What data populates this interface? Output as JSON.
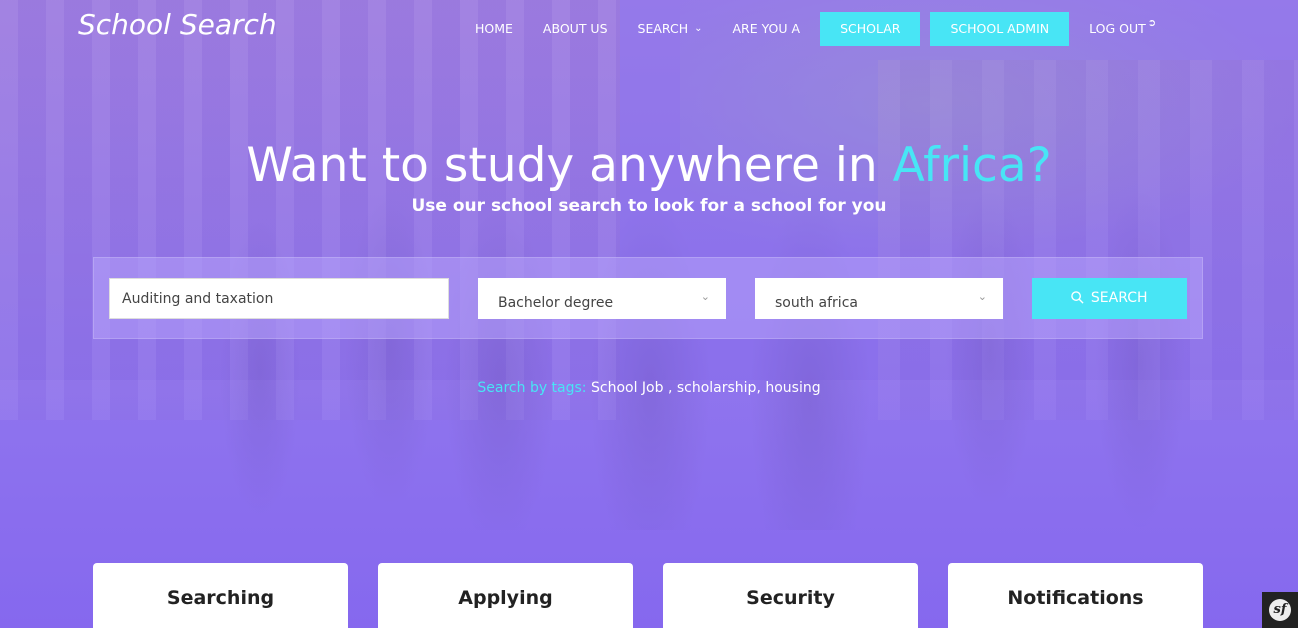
{
  "brand": "School Search",
  "nav": {
    "home": "HOME",
    "about": "ABOUT US",
    "search": "SEARCH",
    "are_you_a": "ARE YOU A",
    "scholar": "SCHOLAR",
    "school_admin": "SCHOOL ADMIN",
    "logout": "LOG OUT"
  },
  "hero": {
    "headline_main": "Want to study anywhere in ",
    "headline_accent": "Africa?",
    "subhead": "Use our school search to look for a school for you"
  },
  "search": {
    "query_value": "Auditing and taxation",
    "degree_selected": "Bachelor degree",
    "country_selected": "south africa",
    "button_label": "SEARCH"
  },
  "tags": {
    "label": "Search by tags:",
    "items": " School Job , scholarship, housing"
  },
  "cards": [
    {
      "title": "Searching"
    },
    {
      "title": "Applying"
    },
    {
      "title": "Security"
    },
    {
      "title": "Notifications"
    }
  ],
  "colors": {
    "accent": "#48e5f5",
    "overlay": "#8d74ea",
    "text": "#ffffff"
  },
  "icons": {
    "search": "magnifier-icon",
    "chevron": "chevron-down-icon",
    "logout": "logout-icon",
    "debug": "symfony-toolbar-icon"
  }
}
